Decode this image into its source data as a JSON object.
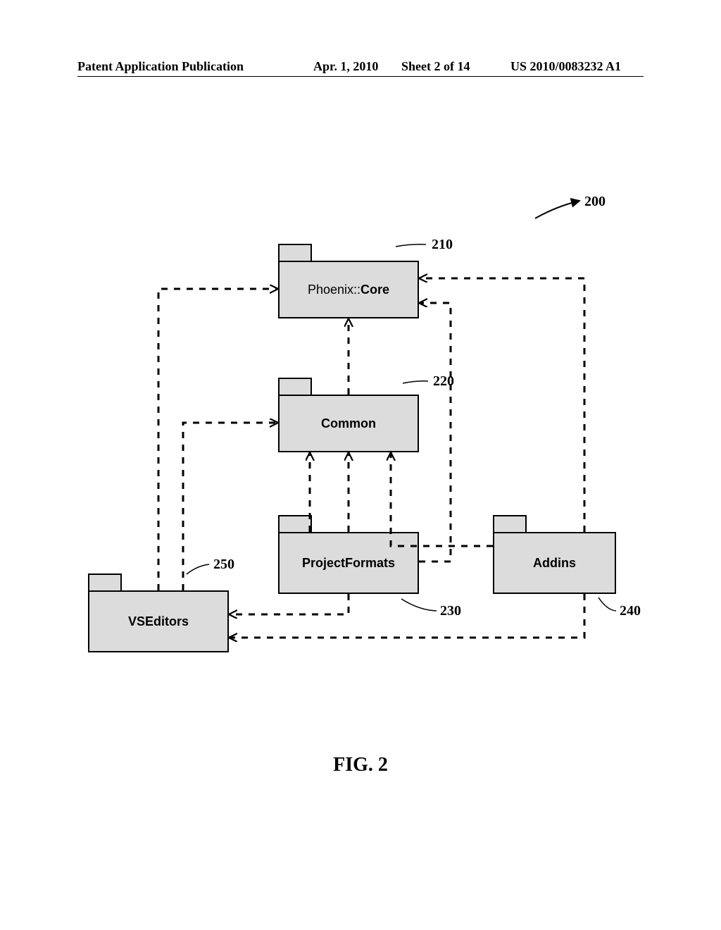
{
  "header": {
    "publication": "Patent Application Publication",
    "date": "Apr. 1, 2010",
    "sheet": "Sheet 2 of 14",
    "patent_no": "US 2010/0083232 A1"
  },
  "figure": {
    "caption": "FIG. 2",
    "system_ref": "200"
  },
  "packages": {
    "core": {
      "label_prefix": "Phoenix::",
      "label_bold": "Core",
      "ref": "210"
    },
    "common": {
      "label": "Common",
      "ref": "220"
    },
    "projectformats": {
      "label": "ProjectFormats",
      "ref": "230"
    },
    "addins": {
      "label": "Addins",
      "ref": "240"
    },
    "vseditors": {
      "label": "VSEditors",
      "ref": "250"
    }
  },
  "chart_data": {
    "type": "uml-package-diagram",
    "packages": [
      {
        "id": "core",
        "name": "Phoenix::Core",
        "ref": 210
      },
      {
        "id": "common",
        "name": "Common",
        "ref": 220
      },
      {
        "id": "projectformats",
        "name": "ProjectFormats",
        "ref": 230
      },
      {
        "id": "addins",
        "name": "Addins",
        "ref": 240
      },
      {
        "id": "vseditors",
        "name": "VSEditors",
        "ref": 250
      }
    ],
    "dependencies": [
      {
        "from": "vseditors",
        "to": "core"
      },
      {
        "from": "vseditors",
        "to": "common"
      },
      {
        "from": "common",
        "to": "core"
      },
      {
        "from": "projectformats",
        "to": "core"
      },
      {
        "from": "projectformats",
        "to": "common"
      },
      {
        "from": "projectformats",
        "to": "vseditors"
      },
      {
        "from": "addins",
        "to": "core"
      },
      {
        "from": "addins",
        "to": "common"
      },
      {
        "from": "addins",
        "to": "vseditors"
      }
    ],
    "system_ref": 200
  }
}
